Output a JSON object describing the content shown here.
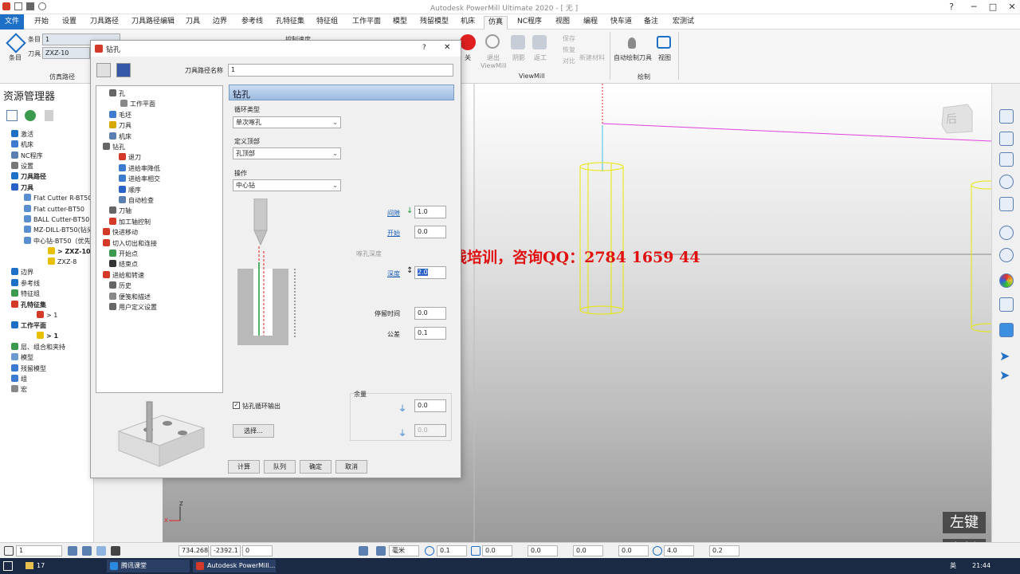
{
  "window": {
    "title": "Autodesk PowerMill Ultimate 2020 - [ 无 ]",
    "help": "?"
  },
  "menu_tabs": [
    "文件",
    "开始",
    "设置",
    "刀具路径",
    "刀具路径编辑",
    "刀具",
    "边界",
    "参考线",
    "孔特征集",
    "特征组",
    "工作平面",
    "模型",
    "残留模型",
    "机床",
    "仿真",
    "NC程序",
    "视图",
    "编程",
    "快车道",
    "备注",
    "宏测试"
  ],
  "ribbon": {
    "entry_label": "条目",
    "entry_value": "1",
    "tool_label": "刀具",
    "tool_value": "ZXZ-10",
    "entry_button": "条目",
    "sim_path_group": "仿真路径",
    "control_speed": "控制速度",
    "off_label": "关",
    "exit_viewmill": "退出\nViewMill",
    "shade": "阴影",
    "rework": "返工",
    "save": "保存",
    "revert": "恢复",
    "compare": "对比",
    "new_material": "新建材料",
    "viewmill_group": "ViewMill",
    "auto_draw_tool": "自动绘制刀具",
    "view": "视图",
    "draw_group": "绘制"
  },
  "explorer": {
    "title": "资源管理器",
    "items": [
      {
        "label": "激活",
        "bold": false
      },
      {
        "label": "机床",
        "bold": false
      },
      {
        "label": "NC程序",
        "bold": false
      },
      {
        "label": "设置",
        "bold": false
      },
      {
        "label": "刀具路径",
        "bold": true
      },
      {
        "label": "刀具",
        "bold": true
      },
      {
        "label": "Flat Cutter R-BT50",
        "bold": false
      },
      {
        "label": "Flat cutter-BT50",
        "bold": false
      },
      {
        "label": "BALL Cutter-BT50",
        "bold": false
      },
      {
        "label": "MZ-DILL-BT50(钻头)",
        "bold": false
      },
      {
        "label": "中心钻-BT50（优先",
        "bold": false
      },
      {
        "label": "> ZXZ-10",
        "bold": true
      },
      {
        "label": "ZXZ-8",
        "bold": false
      },
      {
        "label": "边界",
        "bold": false
      },
      {
        "label": "参考线",
        "bold": false
      },
      {
        "label": "特征组",
        "bold": false
      },
      {
        "label": "孔特征集",
        "bold": true
      },
      {
        "label": "> 1",
        "bold": false
      },
      {
        "label": "工作平面",
        "bold": true
      },
      {
        "label": "> 1",
        "bold": true
      },
      {
        "label": "层、组合和夹持",
        "bold": false
      },
      {
        "label": "模型",
        "bold": false
      },
      {
        "label": "残留模型",
        "bold": false
      },
      {
        "label": "组",
        "bold": false
      },
      {
        "label": "宏",
        "bold": false
      }
    ]
  },
  "dialog": {
    "title": "钻孔",
    "help": "?",
    "close": "✕",
    "path_name_label": "刀具路径名称",
    "path_name_value": "1",
    "tree": [
      "孔",
      "工作平面",
      "毛坯",
      "刀具",
      "机床",
      "钻孔",
      "退刀",
      "进给率降低",
      "进给率相交",
      "顺序",
      "自动检查",
      "刀轴",
      "加工轴控制",
      "快进移动",
      "切入切出和连接",
      "开始点",
      "结束点",
      "进给和转速",
      "历史",
      "便笺和描述",
      "用户定义设置"
    ],
    "section_title": "钻孔",
    "cycle_type_label": "循环类型",
    "cycle_type_value": "单次啄孔",
    "define_top_label": "定义顶部",
    "define_top_value": "孔顶部",
    "operation_label": "操作",
    "operation_value": "中心钻",
    "clearance_label": "间隙",
    "clearance_value": "1.0",
    "start_label": "开始",
    "start_value": "0.0",
    "hole_depth_hint": "啄孔深度",
    "depth_label": "深度",
    "depth_value": "2.0",
    "dwell_label": "停留时间",
    "dwell_value": "0.0",
    "tolerance_label": "公差",
    "tolerance_value": "0.1",
    "drill_cycle_output": "钻孔循环输出",
    "select_button": "选择...",
    "allowance_label": "余量",
    "allowance_value": "0.0",
    "allowance_value2": "0.0",
    "buttons": [
      "计算",
      "队列",
      "确定",
      "取消"
    ]
  },
  "viewport": {
    "view_cube_label": "后",
    "axis_z": "Z",
    "axis_x": "X"
  },
  "watermark": "北斗编程在线培训，咨询QQ：2784 1659 44",
  "left_key": "左键",
  "statusbar": {
    "layer": "1",
    "x": "734.268",
    "y": "-2392.1",
    "z": "0",
    "unit": "毫米",
    "f1": "0.1",
    "f2": "0.0",
    "f3": "0.0",
    "f4": "0.0",
    "f5": "0.0",
    "f6": "4.0",
    "f7": "0.2"
  },
  "taskbar": {
    "folder_count": "17",
    "app1": "腾讯课堂",
    "app2": "Autodesk PowerMill...",
    "lang": "英",
    "time": "21:44"
  },
  "colors": {
    "accent": "#1e6fc6",
    "record_red": "#e02020",
    "wireframe_yellow": "#e8e800",
    "magenta": "#e040e0"
  }
}
